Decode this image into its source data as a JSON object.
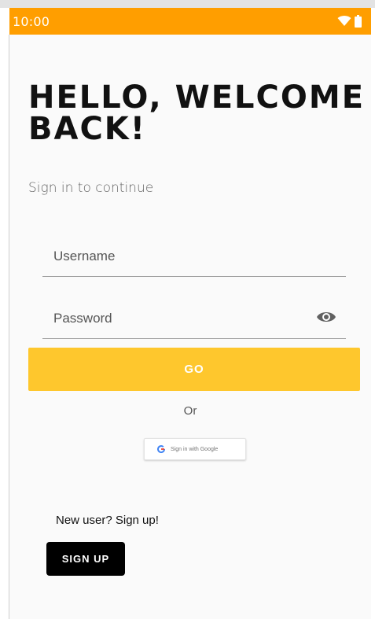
{
  "status_bar": {
    "time": "10:00",
    "icons": [
      "wifi-icon",
      "battery-icon"
    ],
    "background_color": "#ff9e00"
  },
  "header": {
    "title": "HELLO, WELCOME BACK!",
    "subtitle": "Sign in to continue"
  },
  "form": {
    "username": {
      "placeholder": "Username",
      "value": ""
    },
    "password": {
      "placeholder": "Password",
      "value": "",
      "toggle_icon": "eye-icon"
    },
    "go_label": "GO",
    "go_color": "#fec72d"
  },
  "divider": {
    "or_label": "Or"
  },
  "google": {
    "label": "Sign in with Google",
    "icon": "google-g-icon"
  },
  "signup": {
    "prompt": "New user? Sign up!",
    "button_label": "SIGN UP",
    "button_color": "#000000"
  }
}
